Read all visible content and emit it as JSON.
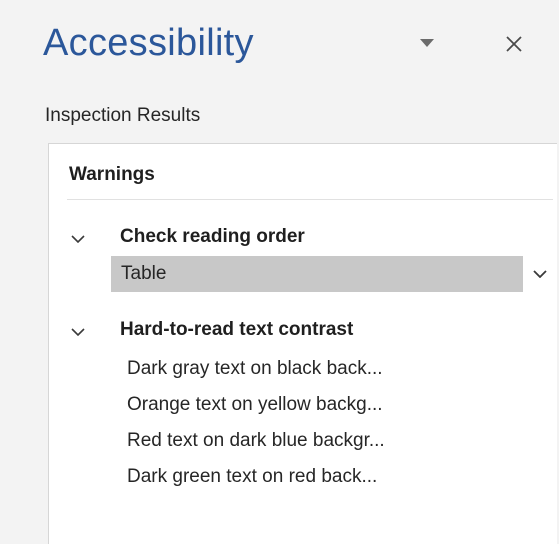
{
  "pane": {
    "title": "Accessibility",
    "options_icon": "caret-down-icon",
    "close_icon": "close-icon"
  },
  "results": {
    "label": "Inspection Results",
    "group": "Warnings",
    "categories": [
      {
        "title": "Check reading order",
        "expanded": true,
        "items": [
          {
            "label": "Table",
            "selected": true
          }
        ]
      },
      {
        "title": "Hard-to-read text contrast",
        "expanded": true,
        "items": [
          {
            "label": "Dark gray text on black back..."
          },
          {
            "label": "Orange text on yellow backg..."
          },
          {
            "label": "Red text on dark blue backgr..."
          },
          {
            "label": "Dark green text on red back..."
          }
        ]
      }
    ]
  },
  "colors": {
    "title_accent": "#2b579a",
    "selected_row": "#c8c8c8",
    "pane_background": "#f3f3f3"
  }
}
